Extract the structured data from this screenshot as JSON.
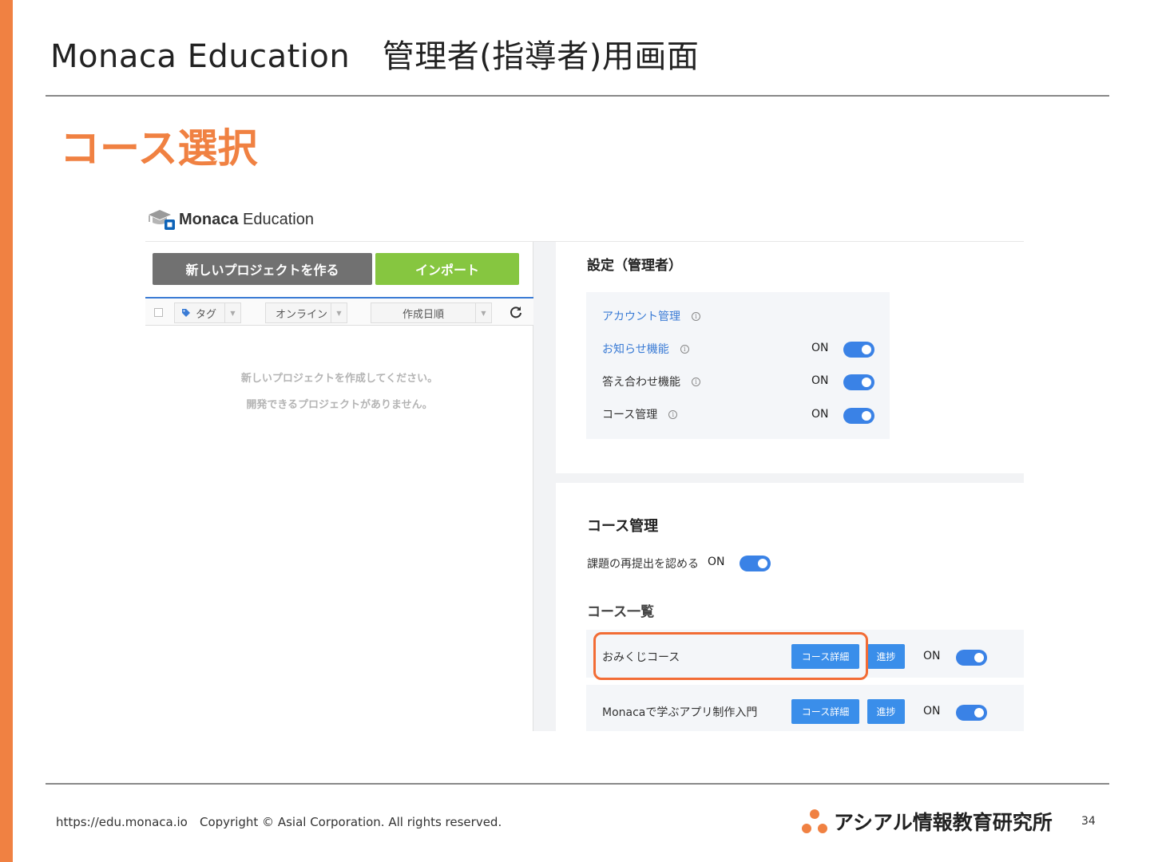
{
  "slide": {
    "title": "Monaca Education　管理者(指導者)用画面",
    "section_title": "コース選択",
    "page_number": "34",
    "accent_color": "#f08142"
  },
  "app": {
    "logo_bold": "Monaca",
    "logo_light": " Education",
    "logo_icon": "graduation-cap-icon"
  },
  "left_panel": {
    "new_project_label": "新しいプロジェクトを作る",
    "import_label": "インポート",
    "filters": {
      "tag_label": "タグ",
      "online_label": "オンライン",
      "sort_label": "作成日順"
    },
    "empty_message_1": "新しいプロジェクトを作成してください。",
    "empty_message_2": "開発できるプロジェクトがありません。"
  },
  "settings": {
    "heading": "設定（管理者）",
    "rows": [
      {
        "label": "アカウント管理",
        "link": true,
        "has_toggle": false
      },
      {
        "label": "お知らせ機能",
        "link": true,
        "has_toggle": true,
        "state": "ON"
      },
      {
        "label": "答え合わせ機能",
        "link": false,
        "has_toggle": true,
        "state": "ON"
      },
      {
        "label": "コース管理",
        "link": false,
        "has_toggle": true,
        "state": "ON"
      }
    ]
  },
  "course_management": {
    "heading": "コース管理",
    "resubmit_label": "課題の再提出を認める",
    "resubmit_state": "ON",
    "list_heading": "コース一覧",
    "courses": [
      {
        "name": "おみくじコース",
        "detail_label": "コース詳細",
        "progress_label": "進捗",
        "state": "ON",
        "highlighted": true
      },
      {
        "name": "Monacaで学ぶアプリ制作入門",
        "detail_label": "コース詳細",
        "progress_label": "進捗",
        "state": "ON",
        "highlighted": false
      }
    ]
  },
  "footer": {
    "url": "https://edu.monaca.io",
    "copyright": "Copyright © Asial Corporation. All rights reserved.",
    "org_name": "アシアル情報教育研究所"
  },
  "colors": {
    "toggle_on": "#3a82e6",
    "button_blue": "#3a8eea",
    "import_green": "#86c640",
    "new_project_gray": "#717171",
    "highlight_orange": "#f26c35"
  }
}
